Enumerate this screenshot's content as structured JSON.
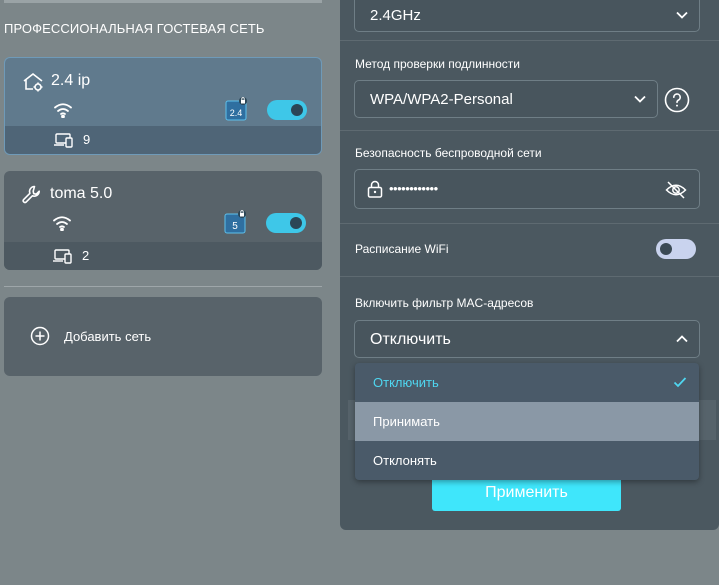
{
  "left": {
    "section_title": "ПРОФЕССИОНАЛЬНАЯ ГОСТЕВАЯ СЕТЬ",
    "networks": [
      {
        "name": "2.4 ip",
        "band": "2.4",
        "devices": "9",
        "enabled": true,
        "icon": "network-settings-icon"
      },
      {
        "name": "toma 5.0",
        "band": "5",
        "devices": "2",
        "enabled": true,
        "icon": "wrench-icon"
      }
    ],
    "add_network_label": "Добавить сеть"
  },
  "panel": {
    "band_value": "2.4GHz",
    "auth_label": "Метод проверки подлинности",
    "auth_value": "WPA/WPA2-Personal",
    "security_label": "Безопасность беспроводной сети",
    "password_mask": "••••••••••••",
    "schedule_label": "Расписание WiFi",
    "schedule_enabled": false,
    "mac_filter_label": "Включить фильтр MAC-адресов",
    "mac_filter_value": "Отключить",
    "apply_label": "Применить"
  },
  "dropdown": {
    "options": [
      "Отключить",
      "Принимать",
      "Отклонять"
    ],
    "selected": "Отключить",
    "hovered": "Принимать"
  },
  "colors": {
    "accent": "#3ec7e8",
    "apply": "#3fe6fb",
    "selected_text": "#4fd6f0"
  }
}
